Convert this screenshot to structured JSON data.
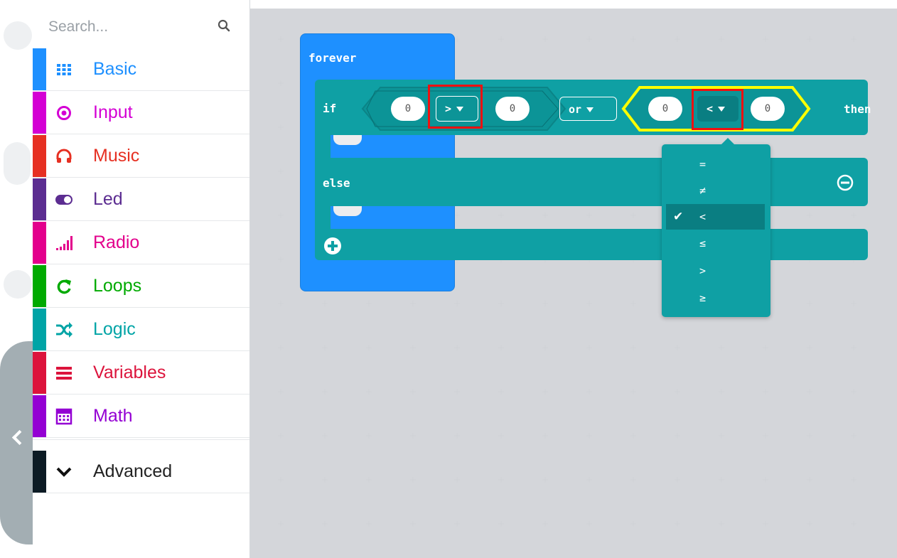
{
  "search": {
    "placeholder": "Search..."
  },
  "toolbox": {
    "categories": [
      {
        "label": "Basic",
        "color": "#1e90ff",
        "icon": "grid-icon"
      },
      {
        "label": "Input",
        "color": "#d400d4",
        "icon": "target-icon"
      },
      {
        "label": "Music",
        "color": "#e63022",
        "icon": "headphones-icon"
      },
      {
        "label": "Led",
        "color": "#5c2d91",
        "icon": "toggle-icon"
      },
      {
        "label": "Radio",
        "color": "#e3008c",
        "icon": "signal-bars-icon"
      },
      {
        "label": "Loops",
        "color": "#00aa00",
        "icon": "loop-arrow-icon"
      },
      {
        "label": "Logic",
        "color": "#00a4a6",
        "icon": "shuffle-icon"
      },
      {
        "label": "Variables",
        "color": "#dc143c",
        "icon": "lines-icon"
      },
      {
        "label": "Math",
        "color": "#9400d3",
        "icon": "calculator-icon"
      }
    ],
    "advanced": {
      "label": "Advanced",
      "color": "#0c1b24",
      "icon": "chevron-down-icon"
    }
  },
  "blocks": {
    "forever": "forever",
    "if": "if",
    "then": "then",
    "else": "else",
    "left_compare": {
      "a": "0",
      "op": ">",
      "b": "0"
    },
    "logic_op": "or",
    "right_compare": {
      "a": "0",
      "op": "<",
      "b": "0"
    }
  },
  "operator_menu": {
    "items": [
      "=",
      "≠",
      "<",
      "≤",
      ">",
      "≥"
    ],
    "selected": "<",
    "check": "✔"
  },
  "colors": {
    "forever": "#1e90ff",
    "logic": "#0fa0a4",
    "highlight": "#ffff00",
    "annotation": "#ee1111"
  }
}
